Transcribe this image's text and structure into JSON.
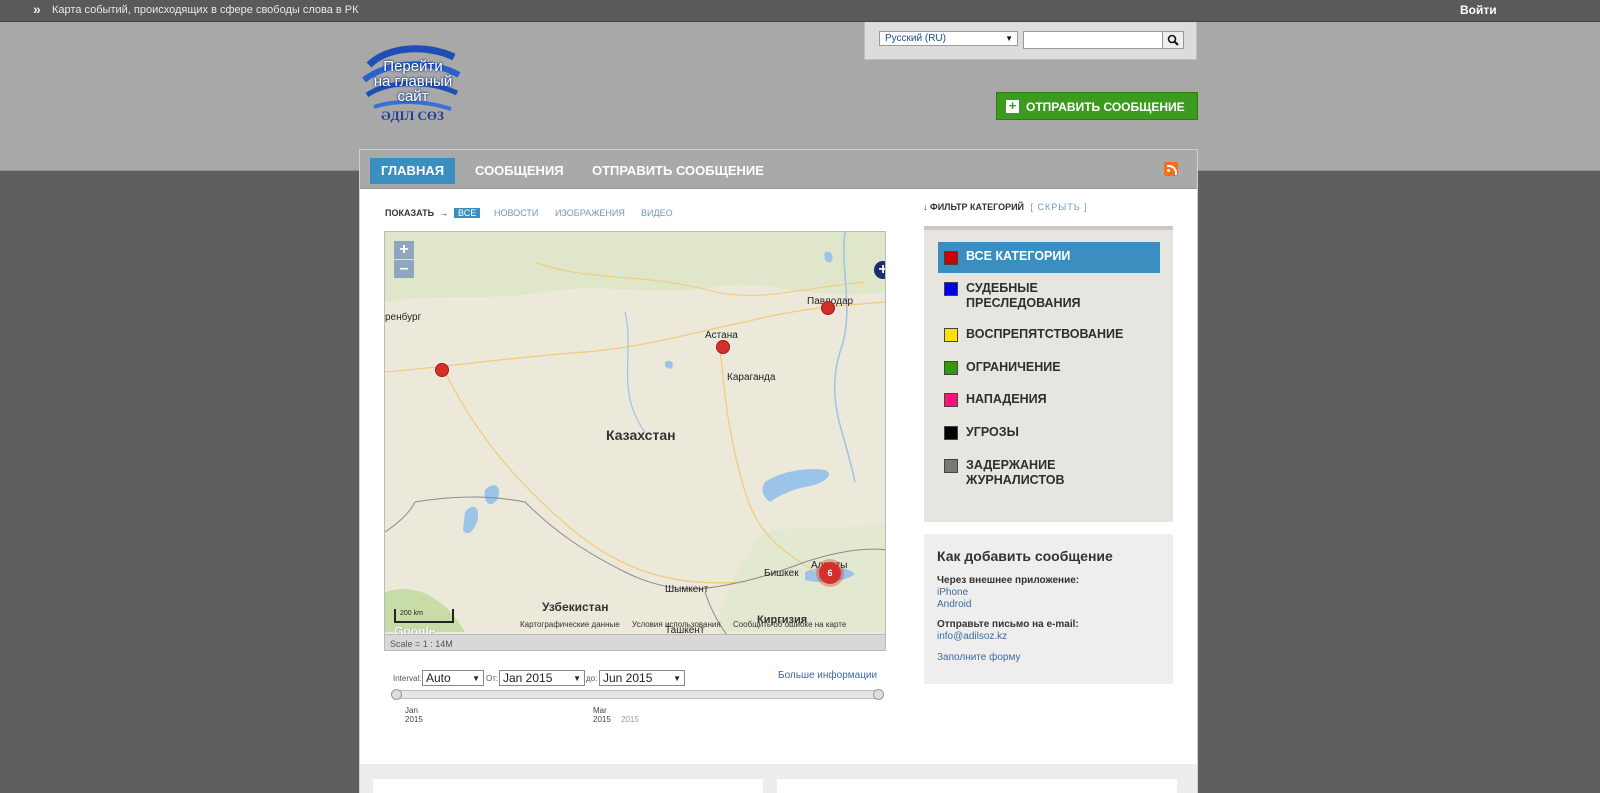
{
  "topbar": {
    "chevron": "»",
    "site_description": "Карта событий, происходящих в сфере свободы слова в РК",
    "login": "Войти"
  },
  "header": {
    "logo_text_line1": "Перейти",
    "logo_text_line2": "на главный",
    "logo_text_line3": "сайт",
    "logo_brand": "ӘДІЛ СӨЗ",
    "language": "Русский (RU)",
    "search_value": "",
    "send_button": "ОТПРАВИТЬ СООБЩЕНИЕ"
  },
  "nav": {
    "items": [
      {
        "label": "ГЛАВНАЯ",
        "active": true
      },
      {
        "label": "СООБЩЕНИЯ",
        "active": false
      },
      {
        "label": "ОТПРАВИТЬ СООБЩЕНИЕ",
        "active": false
      }
    ]
  },
  "show": {
    "label": "ПОКАЗАТЬ",
    "arrow": "→",
    "options": [
      "ВСЕ",
      "НОВОСТИ",
      "ИЗОБРАЖЕНИЯ",
      "ВИДЕО"
    ]
  },
  "map": {
    "zoom_in": "+",
    "zoom_out": "–",
    "layer_switch": "+",
    "labels": {
      "orenburg": "ренбург",
      "pavlodar": "Павлодар",
      "astana": "Астана",
      "karaganda": "Караганда",
      "kazakhstan": "Казахстан",
      "almaty": "Алматы",
      "bishkek": "Бишкек",
      "shymkent": "Шымкент",
      "uzbekistan": "Узбекистан",
      "kyrgyzstan": "Киргизия",
      "tashkent": "Ташкент"
    },
    "cluster_count": "6",
    "scale_km": "200 km",
    "attribution": [
      "Картографические данные",
      "Условия использования",
      "Сообщить об ошибке на карте"
    ],
    "google": "Google",
    "scale_text": "Scale = 1 : 14M"
  },
  "timeline": {
    "interval_label": "Interval:",
    "interval_value": "Auto",
    "from_label": "От:",
    "from_value": "Jan 2015",
    "to_label": "до:",
    "to_value": "Jun 2015",
    "more_info": "Больше информации",
    "ticks": [
      {
        "month": "Jan",
        "year": "2015"
      },
      {
        "month": "Mar",
        "year": "2015"
      }
    ],
    "extra_year": "2015"
  },
  "filter": {
    "arrow": "↓",
    "title": "ФИЛЬТР КАТЕГОРИЙ",
    "hide": "[ СКРЫТЬ ]",
    "categories": [
      {
        "label": "ВСЕ КАТЕГОРИИ",
        "color": "#cc0000",
        "active": true
      },
      {
        "label": "СУДЕБНЫЕ ПРЕСЛЕДОВАНИЯ",
        "color": "#0000ee",
        "active": false
      },
      {
        "label": "ВОСПРЕПЯТСТВОВАНИЕ",
        "color": "#ffe000",
        "active": false
      },
      {
        "label": "ОГРАНИЧЕНИЕ",
        "color": "#339911",
        "active": false
      },
      {
        "label": "НАПАДЕНИЯ",
        "color": "#ff1177",
        "active": false
      },
      {
        "label": "УГРОЗЫ",
        "color": "#000000",
        "active": false
      },
      {
        "label": "ЗАДЕРЖАНИЕ ЖУРНАЛИСТОВ",
        "color": "#777777",
        "active": false
      }
    ]
  },
  "howto": {
    "title": "Как добавить сообщение",
    "via_app": "Через внешнее приложение:",
    "iphone": "iPhone",
    "android": "Android",
    "via_email": "Отправьте письмо на e-mail:",
    "email": "info@adilsoz.kz",
    "form": "Заполните форму"
  }
}
